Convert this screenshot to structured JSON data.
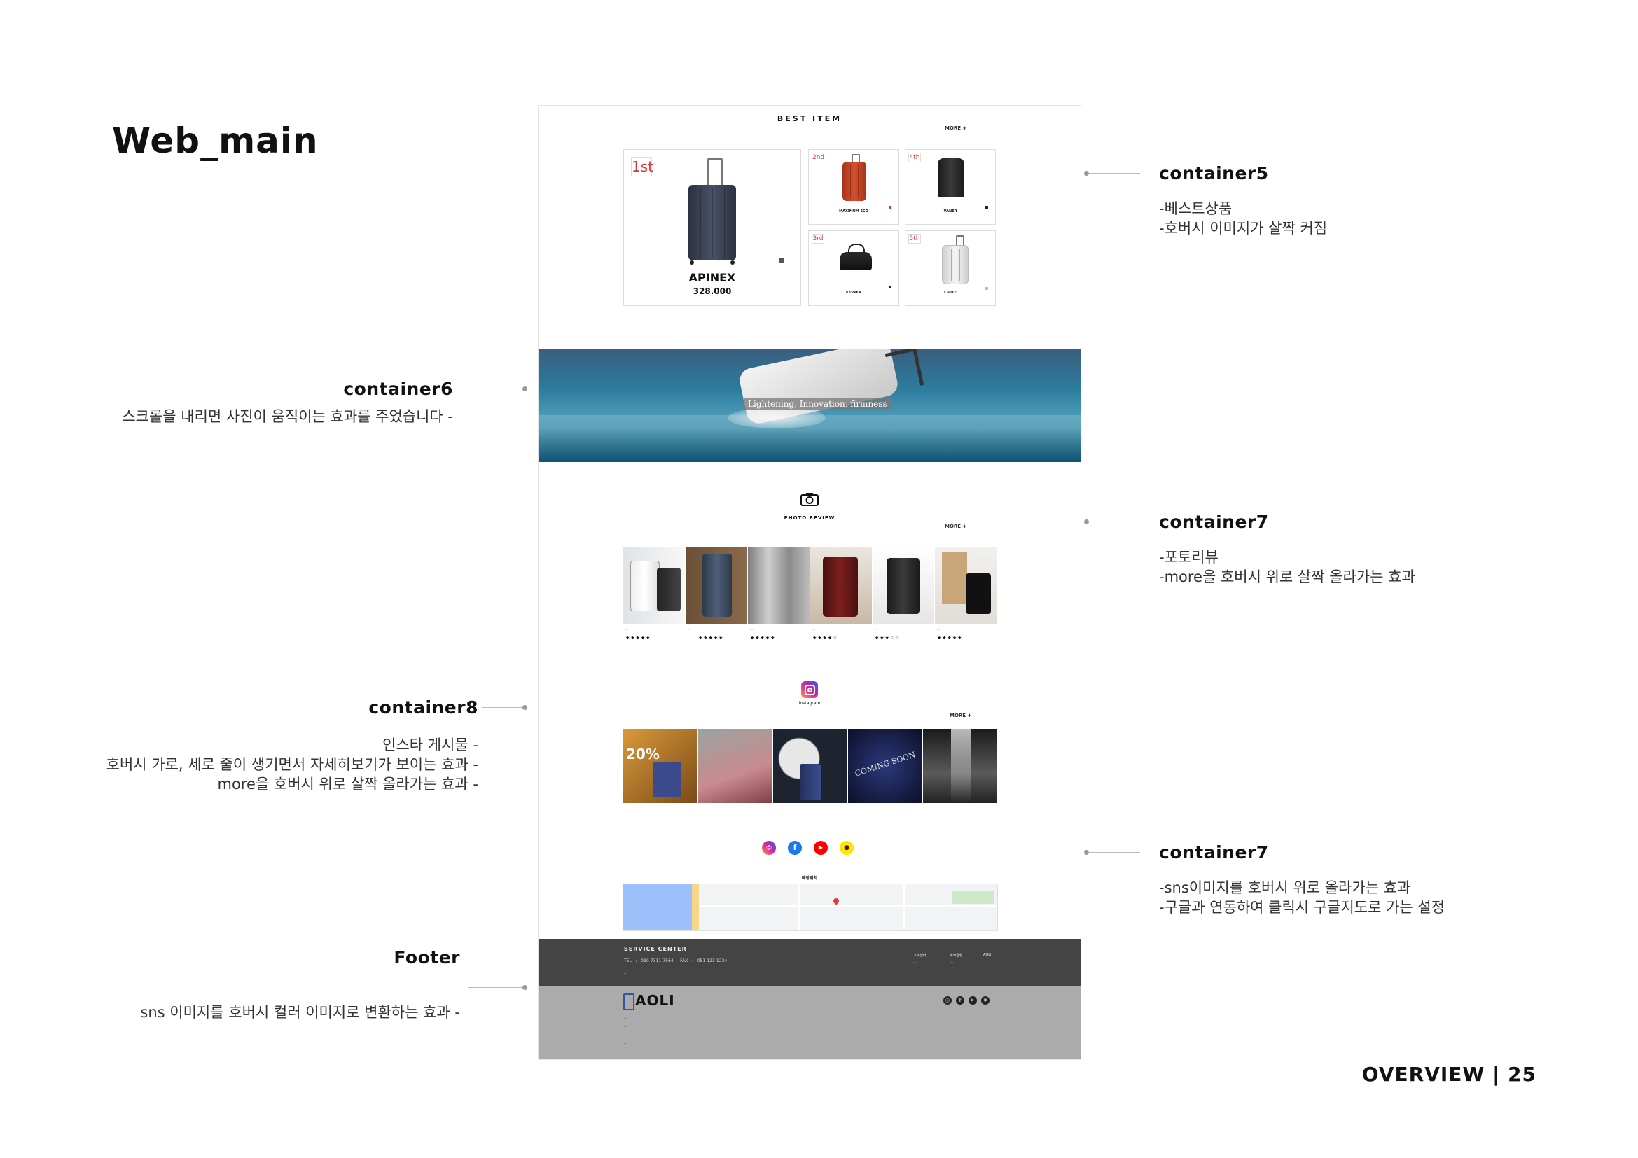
{
  "page": {
    "title": "Web_main",
    "footer_label": "OVERVIEW | 25"
  },
  "annotations": {
    "container5": {
      "title": "container5",
      "lines": [
        "-베스트상품",
        "-호버시 이미지가 살짝 커짐"
      ]
    },
    "container6": {
      "title": "container6",
      "lines": [
        "스크롤을 내리면 사진이 움직이는 효과를 주었습니다 -"
      ]
    },
    "container7a": {
      "title": "container7",
      "lines": [
        "-포토리뷰",
        "-more을 호버시 위로 살짝 올라가는 효과"
      ]
    },
    "container8": {
      "title": "container8",
      "lines": [
        "인스타 게시물 -",
        "호버시 가로, 세로 줄이 생기면서 자세히보기가 보이는 효과 -",
        "more을 호버시 위로 살짝 올라가는 효과 -"
      ]
    },
    "container7b": {
      "title": "container7",
      "lines": [
        "-sns이미지를 호버시 위로 올라가는 효과",
        "-구글과 연동하여 클릭시 구글지도로 가는 설정"
      ]
    },
    "footer": {
      "title": "Footer",
      "lines": [
        "sns 이미지를 호버시 컬러 이미지로 변환하는 효과 -"
      ]
    }
  },
  "mockup": {
    "best": {
      "title": "BEST   ITEM",
      "more": "MORE   +",
      "main": {
        "rank": "1st",
        "name": "APINEX",
        "price": "328.000"
      },
      "items": [
        {
          "rank": "2nd",
          "name": "MAXIMUM   ECO",
          "price": ""
        },
        {
          "rank": "4th",
          "name": "VANER",
          "price": ""
        },
        {
          "rank": "3rd",
          "name": "KEPPER",
          "price": ""
        },
        {
          "rank": "5th",
          "name": "C-LITE",
          "price": ""
        }
      ]
    },
    "banner": {
      "text": "Lightening, Innovation, firmness"
    },
    "review": {
      "title": "PHOTO   REVIEW",
      "more": "MORE   +",
      "items": [
        {
          "stars": "★★★★★",
          "rating": 5
        },
        {
          "stars": "★★★★★",
          "rating": 5
        },
        {
          "stars": "★★★★★",
          "rating": 5
        },
        {
          "stars": "★★★★☆",
          "rating": 4
        },
        {
          "stars": "★★★☆☆",
          "rating": 3
        },
        {
          "stars": "★★★★★",
          "rating": 5
        }
      ]
    },
    "instagram": {
      "label": "Instagram",
      "more": "MORE   +",
      "posts": [
        {
          "overlay": "20%"
        },
        {
          "overlay": ""
        },
        {
          "overlay": ""
        },
        {
          "overlay": "COMING SOON"
        },
        {
          "overlay": ""
        }
      ]
    },
    "sns": {
      "icons": [
        "instagram-icon",
        "facebook-icon",
        "youtube-icon",
        "kakaotalk-icon"
      ]
    },
    "map": {
      "label": "매장위치"
    },
    "footer": {
      "service_title": "SERVICE   CENTER",
      "tel_line": "TEL   :   010-7311-7564     FAX   :   051-123-1234",
      "brand": "AOLI",
      "col_heads": [
        "고객센터",
        "계좌은행",
        "AOLI"
      ]
    },
    "colors": {
      "instagram": "#d6249f",
      "facebook": "#1877f2",
      "youtube": "#ff0000",
      "kakao": "#fee500",
      "footer_dark": "#444444",
      "footer_light": "#ababab"
    }
  }
}
